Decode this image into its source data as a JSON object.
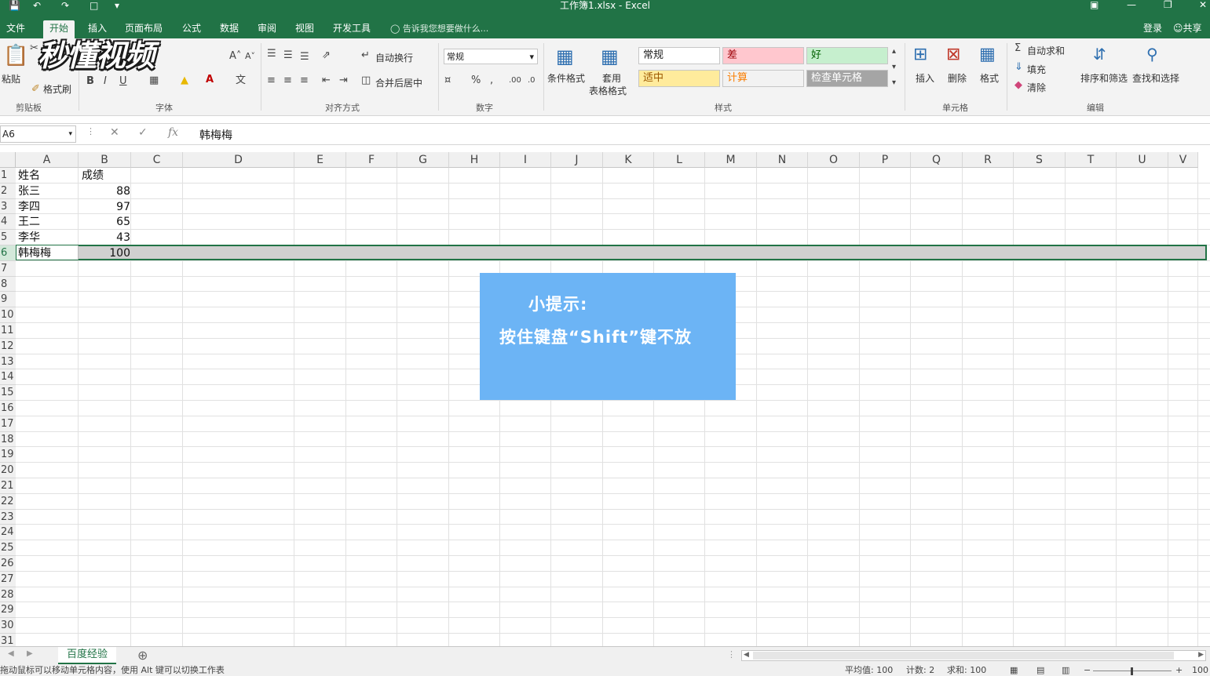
{
  "window": {
    "title": "工作簿1.xlsx - Excel"
  },
  "tabs": [
    {
      "label": "文件"
    },
    {
      "label": "开始"
    },
    {
      "label": "插入"
    },
    {
      "label": "页面布局"
    },
    {
      "label": "公式"
    },
    {
      "label": "数据"
    },
    {
      "label": "审阅"
    },
    {
      "label": "视图"
    },
    {
      "label": "开发工具"
    }
  ],
  "tell_me": "告诉我您想要做什么...",
  "account": {
    "login": "登录",
    "share": "共享"
  },
  "ribbon": {
    "clipboard": {
      "paste": "粘贴",
      "format_painter": "格式刷",
      "label": "剪贴板"
    },
    "font": {
      "bold": "B",
      "italic": "I",
      "underline": "U",
      "label": "字体"
    },
    "alignment": {
      "wrap": "自动换行",
      "merge": "合并后居中",
      "label": "对齐方式"
    },
    "number": {
      "format": "常规",
      "label": "数字"
    },
    "styles": {
      "conditional": "条件格式",
      "table_line1": "套用",
      "table_line2": "表格格式",
      "cells": [
        {
          "label": "常规",
          "bg": "#ffffff",
          "fg": "#222222"
        },
        {
          "label": "差",
          "bg": "#ffc7ce",
          "fg": "#9c0006"
        },
        {
          "label": "好",
          "bg": "#c6efce",
          "fg": "#006100"
        },
        {
          "label": "适中",
          "bg": "#ffeb9c",
          "fg": "#9c5700"
        },
        {
          "label": "计算",
          "bg": "#f2f2f2",
          "fg": "#fa7d00"
        },
        {
          "label": "检查单元格",
          "bg": "#a5a5a5",
          "fg": "#ffffff"
        }
      ],
      "label": "样式"
    },
    "cells": {
      "insert": "插入",
      "delete": "删除",
      "format": "格式",
      "label": "单元格"
    },
    "editing": {
      "autosum": "自动求和",
      "fill": "填充",
      "clear": "清除",
      "sort": "排序和筛选",
      "find": "查找和选择",
      "label": "编辑"
    }
  },
  "logo_text": "秒懂视频",
  "formula_bar": {
    "name_box": "A6",
    "fx": "fx",
    "content": "韩梅梅"
  },
  "columns": [
    "A",
    "B",
    "C",
    "D",
    "E",
    "F",
    "G",
    "H",
    "I",
    "J",
    "K",
    "L",
    "M",
    "N",
    "O",
    "P",
    "Q",
    "R",
    "S",
    "T",
    "U",
    "V"
  ],
  "rows": [
    "1",
    "2",
    "3",
    "4",
    "5",
    "6",
    "7",
    "8",
    "9",
    "10",
    "11",
    "12",
    "13",
    "14",
    "15",
    "16",
    "17",
    "18",
    "19",
    "20",
    "21",
    "22",
    "23",
    "24",
    "25",
    "26",
    "27",
    "28",
    "29",
    "30",
    "31"
  ],
  "table": [
    {
      "name": "姓名",
      "score": "成绩"
    },
    {
      "name": "张三",
      "score": "88"
    },
    {
      "name": "李四",
      "score": "97"
    },
    {
      "name": "王二",
      "score": "65"
    },
    {
      "name": "李华",
      "score": "43"
    },
    {
      "name": "韩梅梅",
      "score": "100"
    }
  ],
  "tip": {
    "title": "小提示:",
    "body": "按住键盘“Shift”键不放"
  },
  "sheet_tab": "百度经验",
  "status": {
    "left": "拖动鼠标可以移动单元格内容，使用 Alt 键可以切换工作表",
    "average": "平均值: 100",
    "count": "计数: 2",
    "sum": "求和: 100",
    "zoom": "100"
  },
  "colors": {
    "excel_green": "#217346",
    "selection": "#d0d0d0",
    "tip_blue": "#6cb4f5"
  }
}
